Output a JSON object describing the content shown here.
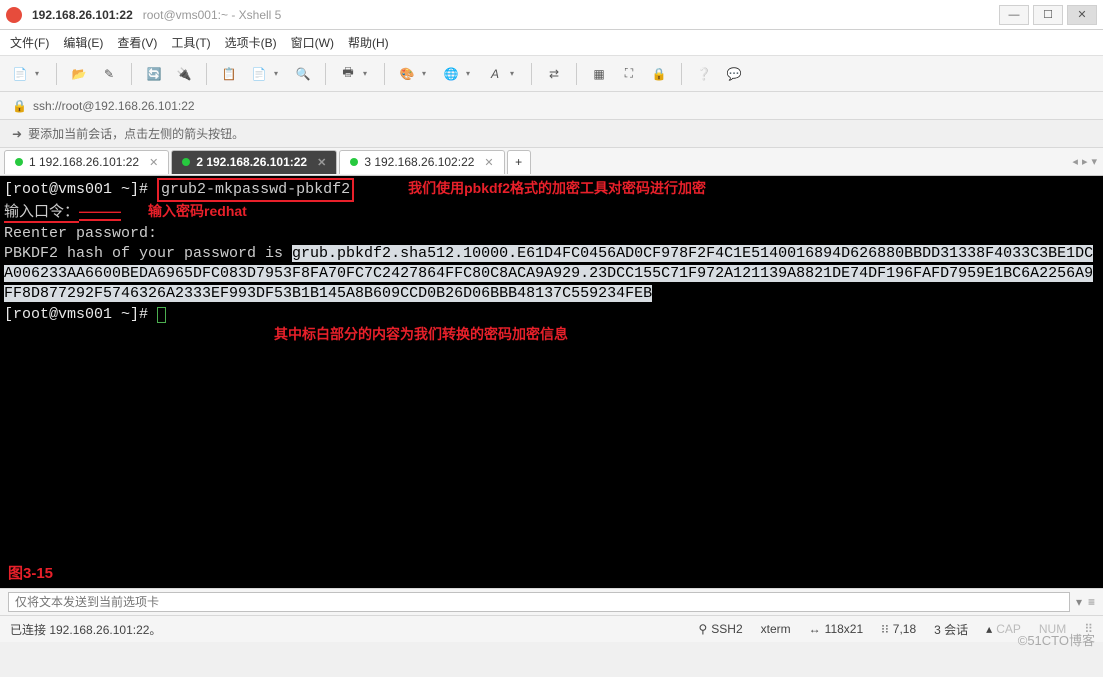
{
  "window": {
    "title_main": "192.168.26.101:22",
    "title_sub": "root@vms001:~ - Xshell 5"
  },
  "menu": {
    "file": "文件(F)",
    "edit": "编辑(E)",
    "view": "查看(V)",
    "tools": "工具(T)",
    "tabs": "选项卡(B)",
    "window": "窗口(W)",
    "help": "帮助(H)"
  },
  "addressbar": {
    "url": "ssh://root@192.168.26.101:22"
  },
  "hint": {
    "icon": "➜",
    "text": "要添加当前会话，点击左侧的箭头按钮。"
  },
  "tabs": [
    {
      "label": "1 192.168.26.101:22",
      "active": false
    },
    {
      "label": "2 192.168.26.101:22",
      "active": true
    },
    {
      "label": "3 192.168.26.102:22",
      "active": false
    }
  ],
  "terminal": {
    "prompt1_user": "[root@vms001 ~]#",
    "command": "grub2-mkpasswd-pbkdf2",
    "ann_cmd": "我们使用pbkdf2格式的加密工具对密码进行加密",
    "enter_pw": "输入口令：",
    "ann_pw": "输入密码redhat",
    "reenter": "Reenter password:",
    "hash_prefix": "PBKDF2 hash of your password is ",
    "hash_value": "grub.pbkdf2.sha512.10000.E61D4FC0456AD0CF978F2F4C1E5140016894D626880BBDD31338F4033C3BE1DCA006233AA6600BEDA6965DFC083D7953F8FA70FC7C2427864FFC80C8ACA9A929.23DCC155C71F972A121139A8821DE74DF196FAFD7959E1BC6A2256A9FF8D877292F5746326A2333EF993DF53B1B145A8B609CCD0B26D06BBB48137C559234FEB",
    "prompt2_user": "[root@vms001 ~]#",
    "ann_hash": "其中标白部分的内容为我们转换的密码加密信息",
    "figure_label": "图3-15"
  },
  "input": {
    "placeholder": "仅将文本发送到当前选项卡"
  },
  "status": {
    "connected": "已连接 192.168.26.101:22。",
    "ssh": "SSH2",
    "term": "xterm",
    "size": "118x21",
    "pos": "7,18",
    "sessions": "3 会话",
    "cap": "CAP",
    "num": "NUM"
  },
  "watermark": "©51CTO博客"
}
